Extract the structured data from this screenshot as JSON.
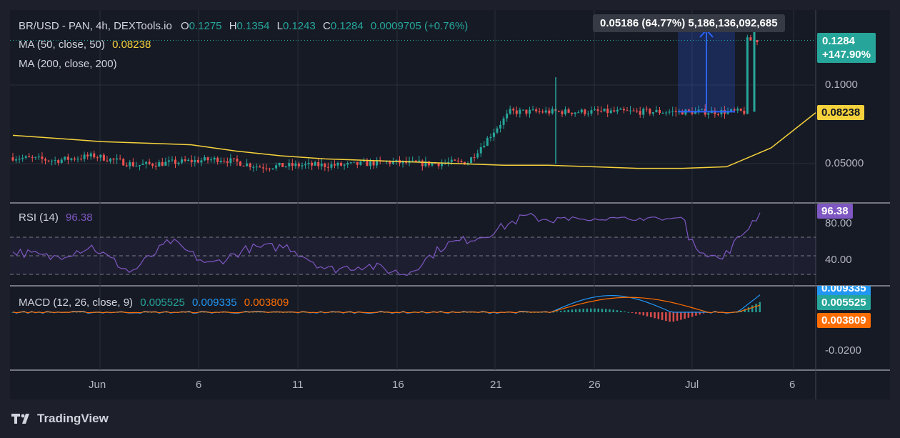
{
  "header": {
    "symbol": "BR/USD - PAN, 4h, DEXTools.io",
    "o_label": "O",
    "o_value": "0.1275",
    "h_label": "H",
    "h_value": "0.1354",
    "l_label": "L",
    "l_value": "0.1243",
    "c_label": "C",
    "c_value": "0.1284",
    "change": "0.0009705 (+0.76%)"
  },
  "ma50": {
    "label": "MA (50, close, 50)",
    "value": "0.08238"
  },
  "ma200": {
    "label": "MA (200, close, 200)"
  },
  "measure_tooltip": "0.05186 (64.77%) 5,186,136,092,685",
  "price_tag": {
    "value": "0.1284",
    "change": "+147.90%"
  },
  "ma_tag": "0.08238",
  "price_ticks": [
    "0.1000",
    "0.05000"
  ],
  "rsi": {
    "label": "RSI (14)",
    "value": "96.38",
    "ticks": [
      "80.00",
      "40.00"
    ]
  },
  "macd": {
    "label": "MACD (12, 26, close, 9)",
    "v1": "0.005525",
    "v2": "0.009335",
    "v3": "0.003809",
    "tags": [
      "0.009335",
      "0.005525",
      "0.003809"
    ],
    "tick": "-0.0200"
  },
  "time_axis": [
    "Jun",
    "6",
    "11",
    "16",
    "21",
    "26",
    "Jul",
    "6"
  ],
  "brand": "TradingView",
  "colors": {
    "up": "#26a69a",
    "down": "#ef5350",
    "ma50": "#f5d23c",
    "rsi": "#7e57c2",
    "macd": "#2196f3",
    "signal": "#ff6d00",
    "text": "#d1d4dc",
    "grid": "#2a2e39"
  },
  "chart_data": [
    {
      "type": "candlestick",
      "title": "BR/USD - PAN, 4h, DEXTools.io",
      "x": [
        "2024-06-01",
        "2024-06-03",
        "2024-06-05",
        "2024-06-07",
        "2024-06-09",
        "2024-06-11",
        "2024-06-13",
        "2024-06-15",
        "2024-06-17",
        "2024-06-19",
        "2024-06-21",
        "2024-06-23",
        "2024-06-24",
        "2024-06-26",
        "2024-06-28",
        "2024-06-30",
        "2024-07-02",
        "2024-07-04",
        "2024-07-05"
      ],
      "close": [
        0.054,
        0.052,
        0.055,
        0.049,
        0.051,
        0.053,
        0.048,
        0.049,
        0.049,
        0.051,
        0.05,
        0.051,
        0.083,
        0.083,
        0.083,
        0.083,
        0.083,
        0.083,
        0.1284
      ],
      "high_last": 0.1354,
      "low_last": 0.1243,
      "open_last": 0.1275,
      "ma50": {
        "name": "MA (50, close, 50)",
        "last": 0.08238,
        "values": [
          0.068,
          0.066,
          0.064,
          0.063,
          0.062,
          0.058,
          0.055,
          0.053,
          0.052,
          0.051,
          0.05,
          0.049,
          0.049,
          0.048,
          0.047,
          0.047,
          0.048,
          0.06,
          0.08238
        ]
      },
      "measurement": {
        "from": 0.083,
        "to": 0.135,
        "change": 0.05186,
        "percent": 64.77
      },
      "y_ticks": [
        0.1,
        0.05
      ]
    },
    {
      "type": "line",
      "title": "RSI (14)",
      "values": [
        55,
        48,
        60,
        32,
        66,
        40,
        58,
        60,
        35,
        40,
        30,
        62,
        72,
        92,
        88,
        87,
        86,
        70,
        45,
        96.38
      ],
      "ylim": [
        20,
        100
      ],
      "bands": [
        70,
        50,
        30
      ],
      "y_ticks": [
        80.0,
        40.0
      ]
    },
    {
      "type": "line",
      "title": "MACD (12, 26, close, 9)",
      "series": [
        {
          "name": "MACD",
          "last": 0.009335
        },
        {
          "name": "Signal",
          "last": 0.003809
        },
        {
          "name": "Histogram",
          "last": 0.005525
        }
      ],
      "y_ticks": [
        -0.02
      ]
    }
  ]
}
